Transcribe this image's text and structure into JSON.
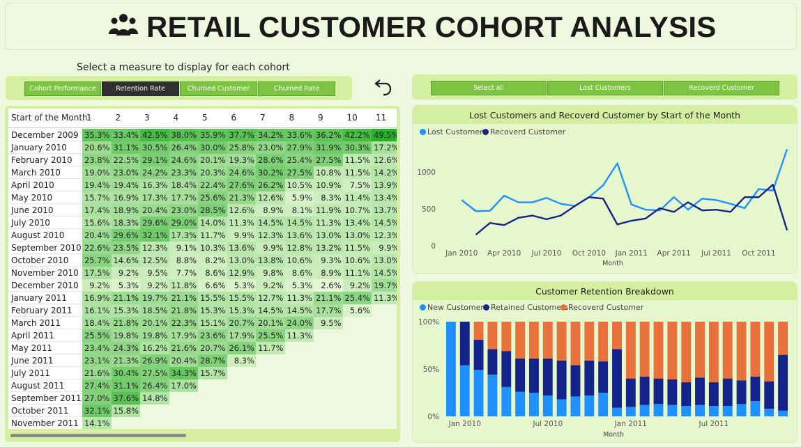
{
  "title": "RETAIL CUSTOMER COHORT ANALYSIS",
  "measure_prompt": "Select a measure to display for each cohort",
  "measure_buttons": [
    "Cohort Performance",
    "Retention Rate",
    "Churned Customer",
    "Churned Rate"
  ],
  "measure_selected": "Retention Rate",
  "filter_buttons": [
    "Select all",
    "Lost Customers",
    "Recoverd Customer"
  ],
  "table": {
    "row_header": "Start of the Month",
    "columns": [
      "1",
      "2",
      "3",
      "4",
      "5",
      "6",
      "7",
      "8",
      "9",
      "10",
      "11"
    ],
    "rows": [
      {
        "label": "December 2009",
        "values": [
          "35.3%",
          "33.4%",
          "42.5%",
          "38.0%",
          "35.9%",
          "37.7%",
          "34.2%",
          "33.6%",
          "36.2%",
          "42.2%",
          "49.5%"
        ]
      },
      {
        "label": "January 2010",
        "values": [
          "20.6%",
          "31.1%",
          "30.5%",
          "26.4%",
          "30.0%",
          "25.8%",
          "23.0%",
          "27.9%",
          "31.9%",
          "30.3%",
          "17.2%"
        ]
      },
      {
        "label": "February 2010",
        "values": [
          "23.8%",
          "22.5%",
          "29.1%",
          "24.6%",
          "20.1%",
          "19.3%",
          "28.6%",
          "25.4%",
          "27.5%",
          "11.5%",
          "12.6%"
        ]
      },
      {
        "label": "March 2010",
        "values": [
          "19.0%",
          "23.0%",
          "24.2%",
          "23.3%",
          "20.3%",
          "24.6%",
          "30.2%",
          "27.5%",
          "10.8%",
          "11.5%",
          "14.2%"
        ]
      },
      {
        "label": "April 2010",
        "values": [
          "19.4%",
          "19.4%",
          "16.3%",
          "18.4%",
          "22.4%",
          "27.6%",
          "26.2%",
          "10.5%",
          "10.9%",
          "7.5%",
          "13.9%"
        ]
      },
      {
        "label": "May 2010",
        "values": [
          "15.7%",
          "16.9%",
          "17.3%",
          "17.7%",
          "25.6%",
          "21.3%",
          "12.6%",
          "5.9%",
          "8.3%",
          "11.4%",
          "13.4%"
        ]
      },
      {
        "label": "June 2010",
        "values": [
          "17.4%",
          "18.9%",
          "20.4%",
          "23.0%",
          "28.5%",
          "12.6%",
          "8.9%",
          "8.1%",
          "11.9%",
          "10.7%",
          "13.7%"
        ]
      },
      {
        "label": "July 2010",
        "values": [
          "15.6%",
          "18.3%",
          "29.6%",
          "29.0%",
          "14.0%",
          "11.3%",
          "14.5%",
          "14.5%",
          "11.3%",
          "13.4%",
          "14.5%"
        ]
      },
      {
        "label": "August 2010",
        "values": [
          "20.4%",
          "29.6%",
          "32.1%",
          "17.3%",
          "11.7%",
          "9.9%",
          "12.3%",
          "13.6%",
          "13.0%",
          "13.0%",
          "12.3%"
        ]
      },
      {
        "label": "September 2010",
        "values": [
          "22.6%",
          "23.5%",
          "12.3%",
          "9.1%",
          "10.3%",
          "13.6%",
          "9.9%",
          "12.8%",
          "13.2%",
          "11.5%",
          "9.9%"
        ]
      },
      {
        "label": "October 2010",
        "values": [
          "25.7%",
          "14.6%",
          "12.5%",
          "8.8%",
          "8.2%",
          "13.0%",
          "13.8%",
          "10.6%",
          "9.3%",
          "10.6%",
          "13.0%"
        ]
      },
      {
        "label": "November 2010",
        "values": [
          "17.5%",
          "9.2%",
          "9.5%",
          "7.7%",
          "8.6%",
          "12.9%",
          "9.8%",
          "8.6%",
          "8.9%",
          "11.1%",
          "14.5%"
        ]
      },
      {
        "label": "December 2010",
        "values": [
          "9.2%",
          "5.3%",
          "9.2%",
          "11.8%",
          "6.6%",
          "5.3%",
          "9.2%",
          "5.3%",
          "2.6%",
          "9.2%",
          "19.7%"
        ]
      },
      {
        "label": "January 2011",
        "values": [
          "16.9%",
          "21.1%",
          "19.7%",
          "21.1%",
          "15.5%",
          "15.5%",
          "12.7%",
          "11.3%",
          "21.1%",
          "25.4%",
          "11.3%"
        ]
      },
      {
        "label": "February 2011",
        "values": [
          "16.1%",
          "15.3%",
          "18.5%",
          "21.8%",
          "15.3%",
          "15.3%",
          "14.5%",
          "14.5%",
          "17.7%",
          "5.6%",
          ""
        ]
      },
      {
        "label": "March 2011",
        "values": [
          "18.4%",
          "21.8%",
          "20.1%",
          "22.3%",
          "15.1%",
          "20.7%",
          "20.1%",
          "24.0%",
          "9.5%",
          "",
          ""
        ]
      },
      {
        "label": "April 2011",
        "values": [
          "25.5%",
          "19.8%",
          "19.8%",
          "17.9%",
          "23.6%",
          "17.9%",
          "25.5%",
          "11.3%",
          "",
          "",
          ""
        ]
      },
      {
        "label": "May 2011",
        "values": [
          "23.4%",
          "24.3%",
          "16.2%",
          "21.6%",
          "20.7%",
          "26.1%",
          "11.7%",
          "",
          "",
          "",
          ""
        ]
      },
      {
        "label": "June 2011",
        "values": [
          "23.1%",
          "21.3%",
          "26.9%",
          "20.4%",
          "28.7%",
          "8.3%",
          "",
          "",
          "",
          "",
          ""
        ]
      },
      {
        "label": "July 2011",
        "values": [
          "21.6%",
          "30.4%",
          "27.5%",
          "34.3%",
          "15.7%",
          "",
          "",
          "",
          "",
          "",
          ""
        ]
      },
      {
        "label": "August 2011",
        "values": [
          "27.4%",
          "31.1%",
          "26.4%",
          "17.0%",
          "",
          "",
          "",
          "",
          "",
          "",
          ""
        ]
      },
      {
        "label": "September 2011",
        "values": [
          "27.0%",
          "37.6%",
          "14.8%",
          "",
          "",
          "",
          "",
          "",
          "",
          "",
          ""
        ]
      },
      {
        "label": "October 2011",
        "values": [
          "32.1%",
          "15.8%",
          "",
          "",
          "",
          "",
          "",
          "",
          "",
          "",
          ""
        ]
      },
      {
        "label": "November 2011",
        "values": [
          "14.1%",
          "",
          "",
          "",
          "",
          "",
          "",
          "",
          "",
          "",
          ""
        ]
      }
    ]
  },
  "chart_data": [
    {
      "type": "line",
      "title": "Lost Customers and Recoverd Customer by Start of the Month",
      "xlabel": "Month",
      "ylabel": "",
      "x_ticks": [
        "Jan 2010",
        "Apr 2010",
        "Jul 2010",
        "Oct 2010",
        "Jan 2011",
        "Apr 2011",
        "Jul 2011",
        "Oct 2011"
      ],
      "y_ticks": [
        "0",
        "500",
        "1000"
      ],
      "ylim": [
        0,
        1370
      ],
      "x": [
        "Jan 2010",
        "Feb 2010",
        "Mar 2010",
        "Apr 2010",
        "May 2010",
        "Jun 2010",
        "Jul 2010",
        "Aug 2010",
        "Sep 2010",
        "Oct 2010",
        "Nov 2010",
        "Dec 2010",
        "Jan 2011",
        "Feb 2011",
        "Mar 2011",
        "Apr 2011",
        "May 2011",
        "Jun 2011",
        "Jul 2011",
        "Aug 2011",
        "Sep 2011",
        "Oct 2011",
        "Nov 2011",
        "Dec 2011"
      ],
      "series": [
        {
          "name": "Lost Customers",
          "color": "#1e90ff",
          "values": [
            null,
            620,
            470,
            475,
            680,
            590,
            590,
            650,
            570,
            540,
            660,
            820,
            1120,
            560,
            490,
            480,
            660,
            490,
            640,
            620,
            570,
            510,
            770,
            750,
            1310
          ]
        },
        {
          "name": "Recoverd Customer",
          "color": "#14238a",
          "values": [
            null,
            null,
            150,
            310,
            280,
            380,
            410,
            360,
            410,
            540,
            660,
            640,
            290,
            340,
            370,
            510,
            460,
            590,
            480,
            490,
            460,
            660,
            660,
            830,
            210
          ]
        }
      ]
    },
    {
      "type": "bar",
      "stacked": "100%",
      "title": "Customer Retention Breakdown",
      "xlabel": "Month",
      "x_ticks": [
        "Jan 2010",
        "Jul 2010",
        "Jan 2011",
        "Jul 2011"
      ],
      "y_ticks": [
        "0%",
        "50%",
        "100%"
      ],
      "ylim": [
        0,
        100
      ],
      "categories": [
        "Dec 2009",
        "Jan 2010",
        "Feb 2010",
        "Mar 2010",
        "Apr 2010",
        "May 2010",
        "Jun 2010",
        "Jul 2010",
        "Aug 2010",
        "Sep 2010",
        "Oct 2010",
        "Nov 2010",
        "Dec 2010",
        "Jan 2011",
        "Feb 2011",
        "Mar 2011",
        "Apr 2011",
        "May 2011",
        "Jun 2011",
        "Jul 2011",
        "Aug 2011",
        "Sep 2011",
        "Oct 2011",
        "Nov 2011",
        "Dec 2011"
      ],
      "series": [
        {
          "name": "New Customers",
          "color": "#1e90ff",
          "values": [
            100,
            54,
            49,
            44,
            31,
            26,
            25,
            22,
            18,
            21,
            22,
            25,
            9,
            10,
            12,
            13,
            12,
            11,
            12,
            11,
            11,
            13,
            16,
            8,
            6
          ]
        },
        {
          "name": "Retained Customers",
          "color": "#14238a",
          "values": [
            0,
            46,
            32,
            27,
            38,
            35,
            36,
            39,
            41,
            33,
            37,
            33,
            62,
            30,
            30,
            27,
            27,
            25,
            29,
            25,
            29,
            25,
            26,
            29,
            59
          ]
        },
        {
          "name": "Recoverd Customer",
          "color": "#e8713c",
          "values": [
            0,
            0,
            19,
            29,
            31,
            39,
            39,
            39,
            41,
            46,
            41,
            42,
            29,
            60,
            58,
            60,
            61,
            64,
            59,
            64,
            60,
            62,
            58,
            63,
            35
          ]
        }
      ]
    }
  ]
}
